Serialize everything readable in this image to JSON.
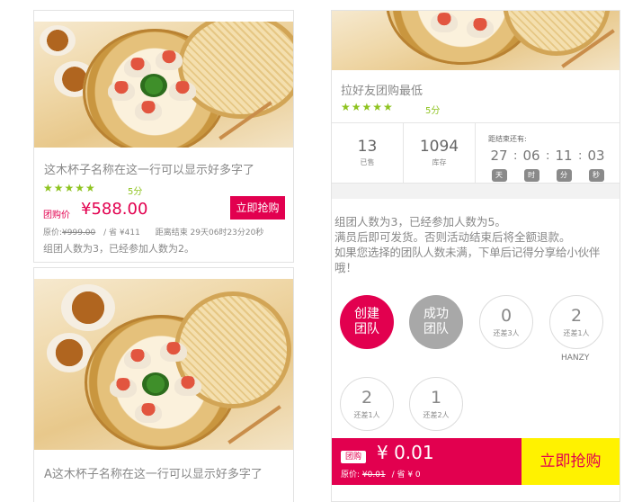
{
  "products": [
    {
      "title": "这木杯子名称在这一行可以显示好多字了",
      "stars": "★★★★★",
      "score": "5分",
      "price_tag": "团购价",
      "price": "¥588.00",
      "buy_label": "立即抢购",
      "orig_label": "原价:",
      "orig_price": "¥999.00",
      "save_text": "/ 省 ¥411",
      "countdown_text": "距离结束 29天06时23分20秒",
      "group_text": "组团人数为3，已经参加人数为2。"
    },
    {
      "title": "A这木杯子名称在这一行可以显示好多字了"
    }
  ],
  "detail": {
    "title": "拉好友团购最低",
    "stars": "★★★★★",
    "score": "5分",
    "sold_num": "13",
    "sold_label": "已售",
    "stock_num": "1094",
    "stock_label": "库存",
    "countdown_label": "距结束还有:",
    "countdown": [
      {
        "value": "27",
        "unit": "天"
      },
      {
        "value": "06",
        "unit": "时"
      },
      {
        "value": "11",
        "unit": "分"
      },
      {
        "value": "03",
        "unit": "秒"
      }
    ],
    "info_lines": [
      "组团人数为3，已经参加人数为5。",
      "满员后即可发货。否则活动结束后将全额退款。",
      "如果您选择的团队人数未满，下单后记得分享给小伙伴",
      "哦！"
    ],
    "create_team": [
      "创建",
      "团队"
    ],
    "success_team": [
      "成功",
      "团队"
    ],
    "teams": [
      {
        "num": "0",
        "label": "还差3人",
        "member": ""
      },
      {
        "num": "2",
        "label": "还差1人",
        "member": "HANZY"
      },
      {
        "num": "2",
        "label": "还差1人",
        "member": ""
      },
      {
        "num": "1",
        "label": "还差2人",
        "member": ""
      }
    ],
    "bottom": {
      "tag": "团购",
      "price": "¥ 0.01",
      "orig_label": "原价:",
      "orig_price": "¥0.01",
      "save_text": "/ 省 ¥ 0",
      "buy_label": "立即抢购"
    }
  },
  "colors": {
    "accent": "#e2004f",
    "star": "#8ec31f",
    "buy_yellow": "#fff200"
  }
}
